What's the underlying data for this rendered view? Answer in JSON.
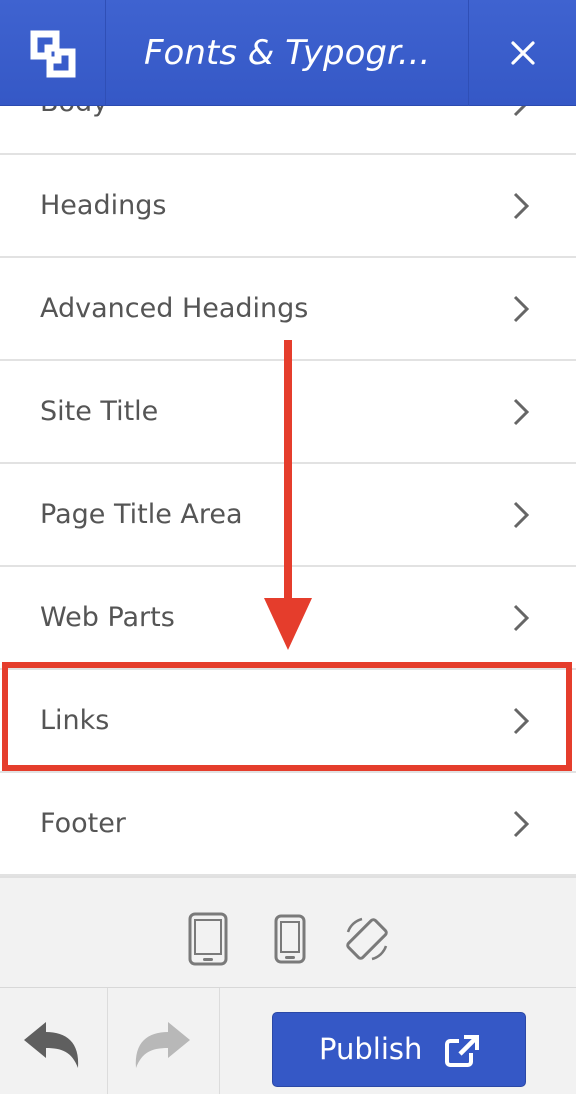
{
  "header": {
    "title": "Fonts & Typogr...",
    "logo_icon": "layout-logo-icon",
    "close_icon": "close-icon",
    "color": "#3558c6"
  },
  "menu": {
    "items": [
      {
        "label": "Body"
      },
      {
        "label": "Headings"
      },
      {
        "label": "Advanced Headings"
      },
      {
        "label": "Site Title"
      },
      {
        "label": "Page Title Area"
      },
      {
        "label": "Web Parts"
      },
      {
        "label": "Links"
      },
      {
        "label": "Footer"
      }
    ],
    "highlighted": "Links",
    "annotation_color": "#e53d2c"
  },
  "devices": {
    "icons": [
      "tablet-icon",
      "phone-icon",
      "rotate-icon"
    ]
  },
  "footer": {
    "undo_icon": "undo-icon",
    "redo_icon": "redo-icon",
    "publish_label": "Publish",
    "publish_icon": "external-link-icon"
  }
}
